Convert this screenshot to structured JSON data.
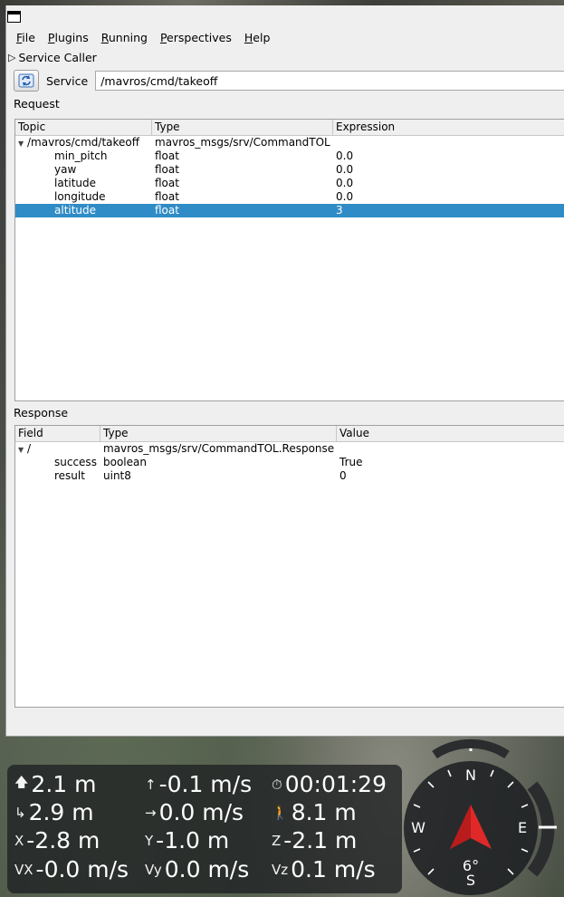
{
  "menu": {
    "items": [
      {
        "label": "File",
        "accel": "F",
        "rest": "ile"
      },
      {
        "label": "Plugins",
        "accel": "P",
        "rest": "lugins"
      },
      {
        "label": "Running",
        "accel": "R",
        "rest": "unning"
      },
      {
        "label": "Perspectives",
        "accel": "P",
        "rest": "erspectives"
      },
      {
        "label": "Help",
        "accel": "H",
        "rest": "elp"
      }
    ]
  },
  "plugin": {
    "title": "Service Caller"
  },
  "service": {
    "label": "Service",
    "value": "/mavros/cmd/takeoff"
  },
  "request": {
    "label": "Request",
    "headers": [
      "Topic",
      "Type",
      "Expression"
    ],
    "root": {
      "topic": "/mavros/cmd/takeoff",
      "type": "mavros_msgs/srv/CommandTOL",
      "expr": ""
    },
    "rows": [
      {
        "topic": "min_pitch",
        "type": "float",
        "expr": "0.0"
      },
      {
        "topic": "yaw",
        "type": "float",
        "expr": "0.0"
      },
      {
        "topic": "latitude",
        "type": "float",
        "expr": "0.0"
      },
      {
        "topic": "longitude",
        "type": "float",
        "expr": "0.0"
      },
      {
        "topic": "altitude",
        "type": "float",
        "expr": "3"
      }
    ]
  },
  "response": {
    "label": "Response",
    "headers": [
      "Field",
      "Type",
      "Value"
    ],
    "root": {
      "field": "/",
      "type": "mavros_msgs/srv/CommandTOL.Response",
      "value": ""
    },
    "rows": [
      {
        "field": "success",
        "type": "boolean",
        "value": "True"
      },
      {
        "field": "result",
        "type": "uint8",
        "value": "0"
      }
    ]
  },
  "hud": {
    "altitude": "2.1 m",
    "distance": "2.9 m",
    "x": "-2.8 m",
    "vx": "-0.0 m/s",
    "vertical_speed": "-0.1 m/s",
    "ground_speed": "0.0 m/s",
    "y": "-1.0 m",
    "vy": "0.0 m/s",
    "flight_time": "00:01:29",
    "home_distance": "8.1 m",
    "z": "-2.1 m",
    "vz": "0.1 m/s",
    "labels": {
      "x": "X",
      "y": "Y",
      "z": "Z",
      "vx": "VX",
      "vy": "Vy",
      "vz": "Vz"
    }
  },
  "compass": {
    "n": "N",
    "e": "E",
    "s": "S",
    "w": "W",
    "heading": "6°"
  },
  "colors": {
    "selection": "#308cc6",
    "compass_arrow": "#e02828"
  }
}
